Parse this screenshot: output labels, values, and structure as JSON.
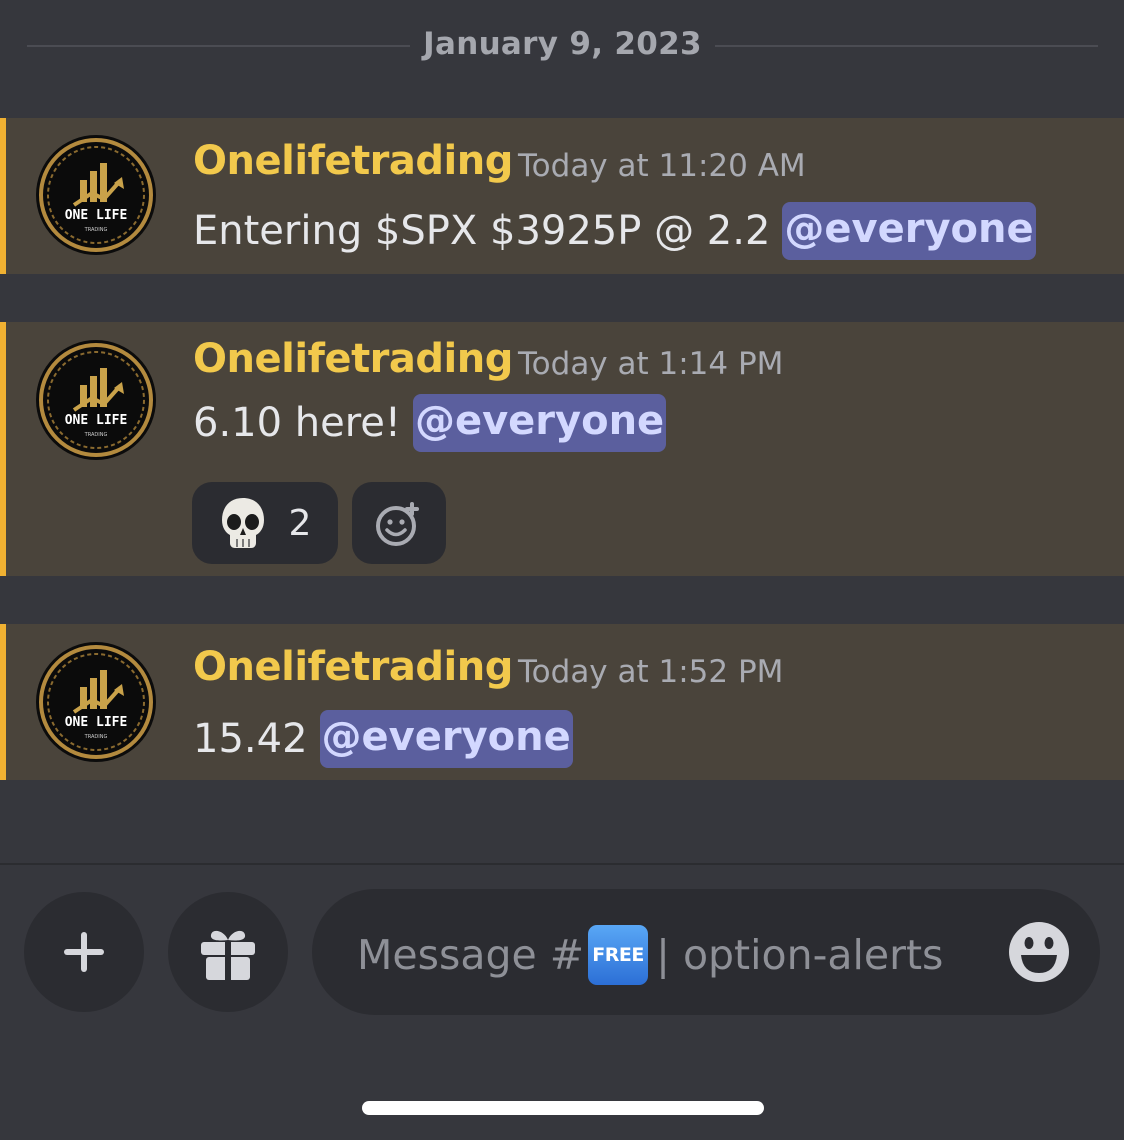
{
  "date_separator": "January 9, 2023",
  "messages": [
    {
      "username": "Onelifetrading",
      "timestamp": "Today at 11:20 AM",
      "text": "Entering $SPX $3925P @ 2.2",
      "mention": "@everyone"
    },
    {
      "username": "Onelifetrading",
      "timestamp": "Today at 1:14 PM",
      "text": "6.10 here!",
      "mention": "@everyone",
      "reactions": [
        {
          "emoji": "skull",
          "count": "2"
        }
      ]
    },
    {
      "username": "Onelifetrading",
      "timestamp": "Today at 1:52 PM",
      "text": "15.42",
      "mention": "@everyone"
    }
  ],
  "avatar": {
    "text_line1": "ONE LIFE",
    "text_line2": "TRADING"
  },
  "composer": {
    "placeholder_prefix": "Message #",
    "badge": "FREE",
    "placeholder_suffix": "| option-alerts"
  },
  "icons": {
    "attach": "plus-icon",
    "gift": "gift-icon",
    "emoji": "smiley-face-icon",
    "add_reaction": "add-reaction-icon"
  },
  "colors": {
    "background": "#36373d",
    "highlight": "#4a443b",
    "accent_bar": "#f0b132",
    "username": "#f2c94c",
    "mention_bg": "#5b5f9e"
  }
}
